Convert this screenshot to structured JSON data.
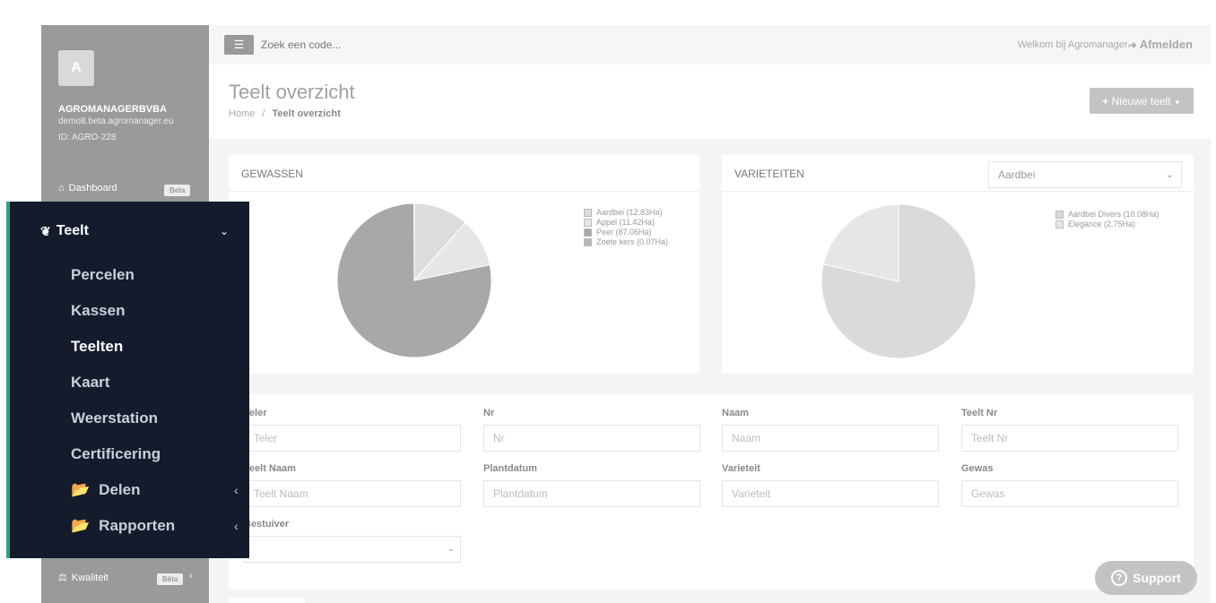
{
  "sidebar": {
    "avatar_letter": "A",
    "company": "AGROMANAGERBVBA",
    "domain": "demo8.beta.agromanager.eu",
    "account_id": "ID: AGRO-228",
    "dashboard_label": "Dashboard",
    "dashboard_badge": "Beta",
    "kwaliteit_label": "Kwaliteit",
    "kwaliteit_badge": "Bèta"
  },
  "teelt_menu": {
    "title": "Teelt",
    "items": [
      "Percelen",
      "Kassen",
      "Teelten",
      "Kaart",
      "Weerstation",
      "Certificering"
    ],
    "active": "Teelten",
    "folders": [
      "Delen",
      "Rapporten"
    ]
  },
  "topbar": {
    "search_placeholder": "Zoek een code...",
    "welcome": "Welkom bij Agromanager.",
    "logout": "Afmelden"
  },
  "page": {
    "title": "Teelt overzicht",
    "breadcrumb_home": "Home",
    "breadcrumb_separator": "/",
    "breadcrumb_current": "Teelt overzicht",
    "new_button": "Nieuwe teelt"
  },
  "gewassen": {
    "title": "GEWASSEN",
    "legend": [
      "Aardbei (12.83Ha)",
      "Appel (11.42Ha)",
      "Peer (87.06Ha)",
      "Zoete kers (0.07Ha)"
    ],
    "values": [
      12.83,
      11.42,
      87.06,
      0.07
    ],
    "colors": [
      "#dcdcdc",
      "#e6e6e6",
      "#a8a8a8",
      "#b8b8b8"
    ]
  },
  "varieteiten": {
    "title": "VARIETEITEN",
    "select_value": "Aardbei",
    "legend": [
      "Aardbei Divers (10.08Ha)",
      "Elegance (2.75Ha)"
    ],
    "values": [
      10.08,
      2.75
    ],
    "colors": [
      "#dadada",
      "#e6e6e6"
    ]
  },
  "filters": {
    "teler_label": "Teler",
    "teler_placeholder": "Teler",
    "nr_label": "Nr",
    "nr_placeholder": "Nr",
    "naam_label": "Naam",
    "naam_placeholder": "Naam",
    "teeltnr_label": "Teelt Nr",
    "teeltnr_placeholder": "Teelt Nr",
    "teeltnaam_label": "Teelt Naam",
    "teeltnaam_placeholder": "Teelt Naam",
    "plantdatum_label": "Plantdatum",
    "plantdatum_placeholder": "Plantdatum",
    "varieteit_label": "Varieteit",
    "varieteit_placeholder": "Varieteit",
    "gewas_label": "Gewas",
    "gewas_placeholder": "Gewas",
    "bestuiver_label": "Bestuiver"
  },
  "support": {
    "label": "Support"
  }
}
